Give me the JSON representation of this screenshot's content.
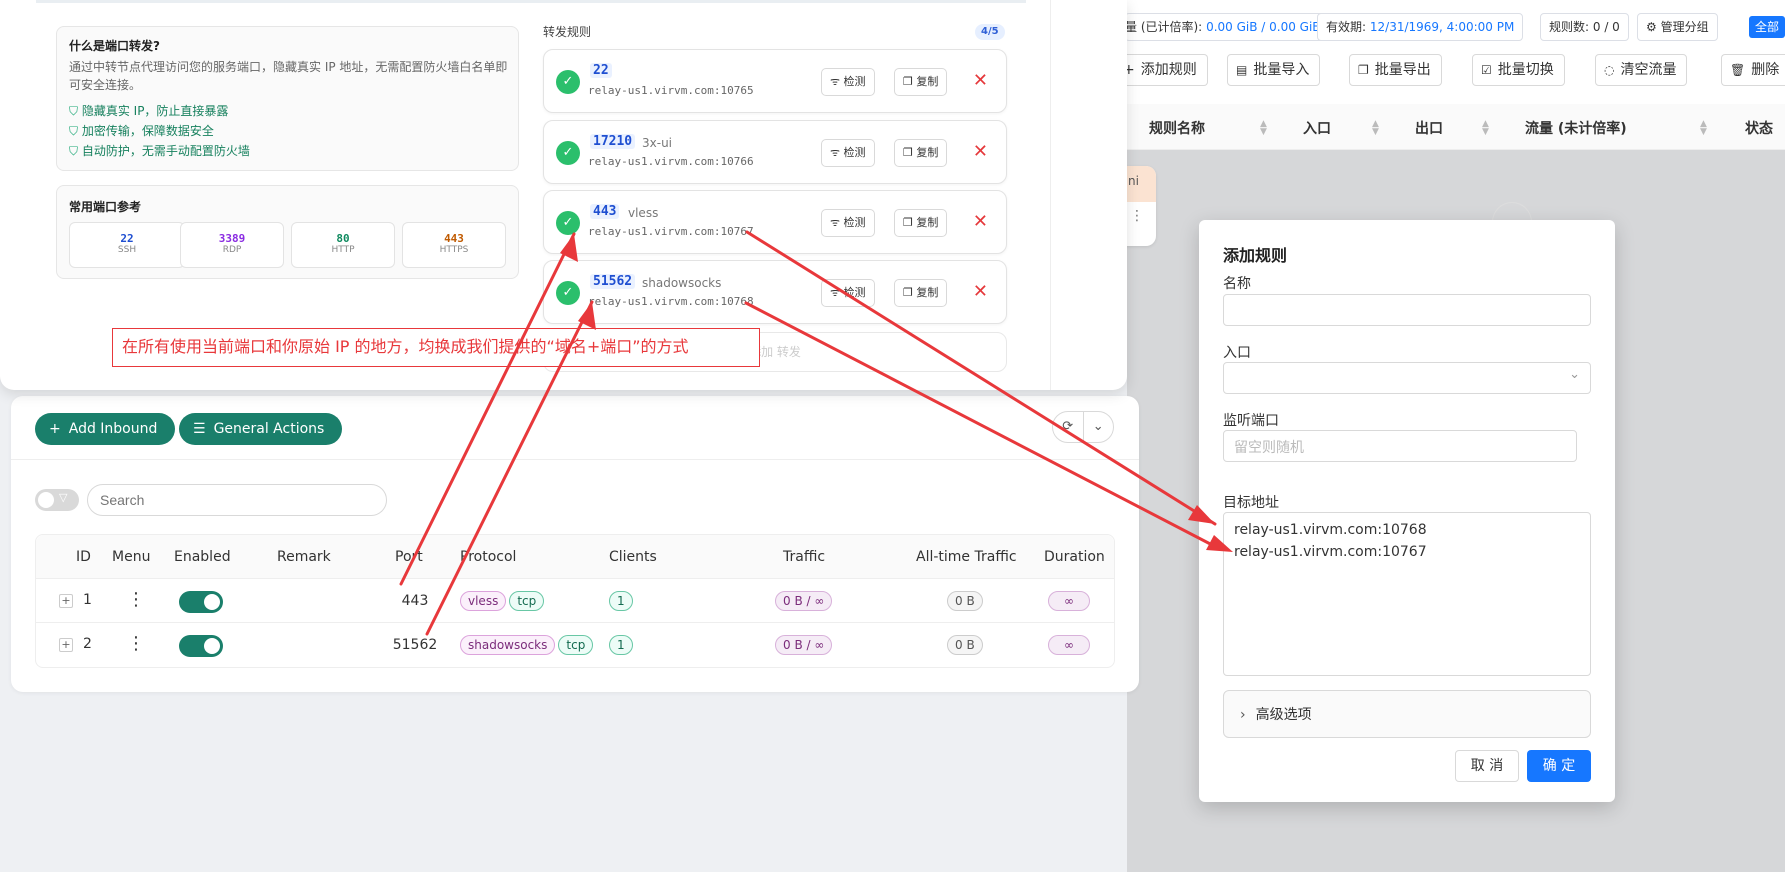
{
  "right_app": {
    "stats": [
      {
        "label": "量 (已计倍率):",
        "value": "0.00 GiB / 0.00 GiB"
      },
      {
        "label": "有效期:",
        "value": "12/31/1969, 4:00:00 PM"
      },
      {
        "label": "规则数:",
        "value": "0 / 0"
      }
    ],
    "manage_group": "管理分组",
    "all_label": "全部",
    "toolbar": [
      "添加规则",
      "批量导入",
      "批量导出",
      "批量切换",
      "清空流量",
      "删除"
    ],
    "columns": [
      "规则名称",
      "入口",
      "出口",
      "流量 (未计倍率)",
      "状态"
    ],
    "fragment_text": "ni"
  },
  "popup": {
    "faq_title": "什么是端口转发?",
    "faq_desc": "通过中转节点代理访问您的服务端口，隐藏真实 IP 地址，无需配置防火墙白名单即可安全连接。",
    "benefits": [
      "隐藏真实 IP，防止直接暴露",
      "加密传输，保障数据安全",
      "自动防护，无需手动配置防火墙"
    ],
    "ports_title": "常用端口参考",
    "common_ports": [
      {
        "port": "22",
        "name": "SSH",
        "color": "#1f4fd1"
      },
      {
        "port": "3389",
        "name": "RDP",
        "color": "#8a2be2"
      },
      {
        "port": "80",
        "name": "HTTP",
        "color": "#0f8a5f"
      },
      {
        "port": "443",
        "name": "HTTPS",
        "color": "#c05a00"
      }
    ],
    "rules_title": "转发规则",
    "rules_count": "4/5",
    "rules": [
      {
        "port": "22",
        "name": "",
        "addr": "relay-us1.virvm.com:10765"
      },
      {
        "port": "17210",
        "name": "3x-ui",
        "addr": "relay-us1.virvm.com:10766"
      },
      {
        "port": "443",
        "name": "vless",
        "addr": "relay-us1.virvm.com:10767"
      },
      {
        "port": "51562",
        "name": "shadowsocks",
        "addr": "relay-us1.virvm.com:10768"
      }
    ],
    "check_label": "检测",
    "copy_label": "复制",
    "faded_text": "添加 转发",
    "annotation": "在所有使用当前端口和你原始 IP 的地方，均换成我们提供的“域名+端口”的方式"
  },
  "panel": {
    "add_inbound": "Add Inbound",
    "general_actions": "General Actions",
    "search_placeholder": "Search",
    "columns": [
      "ID",
      "Menu",
      "Enabled",
      "Remark",
      "Port",
      "Protocol",
      "Clients",
      "Traffic",
      "All-time Traffic",
      "Duration"
    ],
    "rows": [
      {
        "id": "1",
        "port": "443",
        "protocol": "vless",
        "transport": "tcp",
        "clients": "1",
        "traffic": "0 B / ∞",
        "alltime": "0 B",
        "duration": "∞"
      },
      {
        "id": "2",
        "port": "51562",
        "protocol": "shadowsocks",
        "transport": "tcp",
        "clients": "1",
        "traffic": "0 B / ∞",
        "alltime": "0 B",
        "duration": "∞"
      }
    ]
  },
  "dialog": {
    "title": "添加规则",
    "name_label": "名称",
    "entry_label": "入口",
    "listen_label": "监听端口",
    "listen_placeholder": "留空则随机",
    "target_label": "目标地址",
    "target_lines": [
      "relay-us1.virvm.com:10768",
      "relay-us1.virvm.com:10767"
    ],
    "advanced": "高级选项",
    "cancel": "取 消",
    "ok": "确 定"
  },
  "colors": {
    "accent_green": "#1a7f6b",
    "primary_blue": "#1677ff",
    "annotation_red": "#e8383b"
  }
}
